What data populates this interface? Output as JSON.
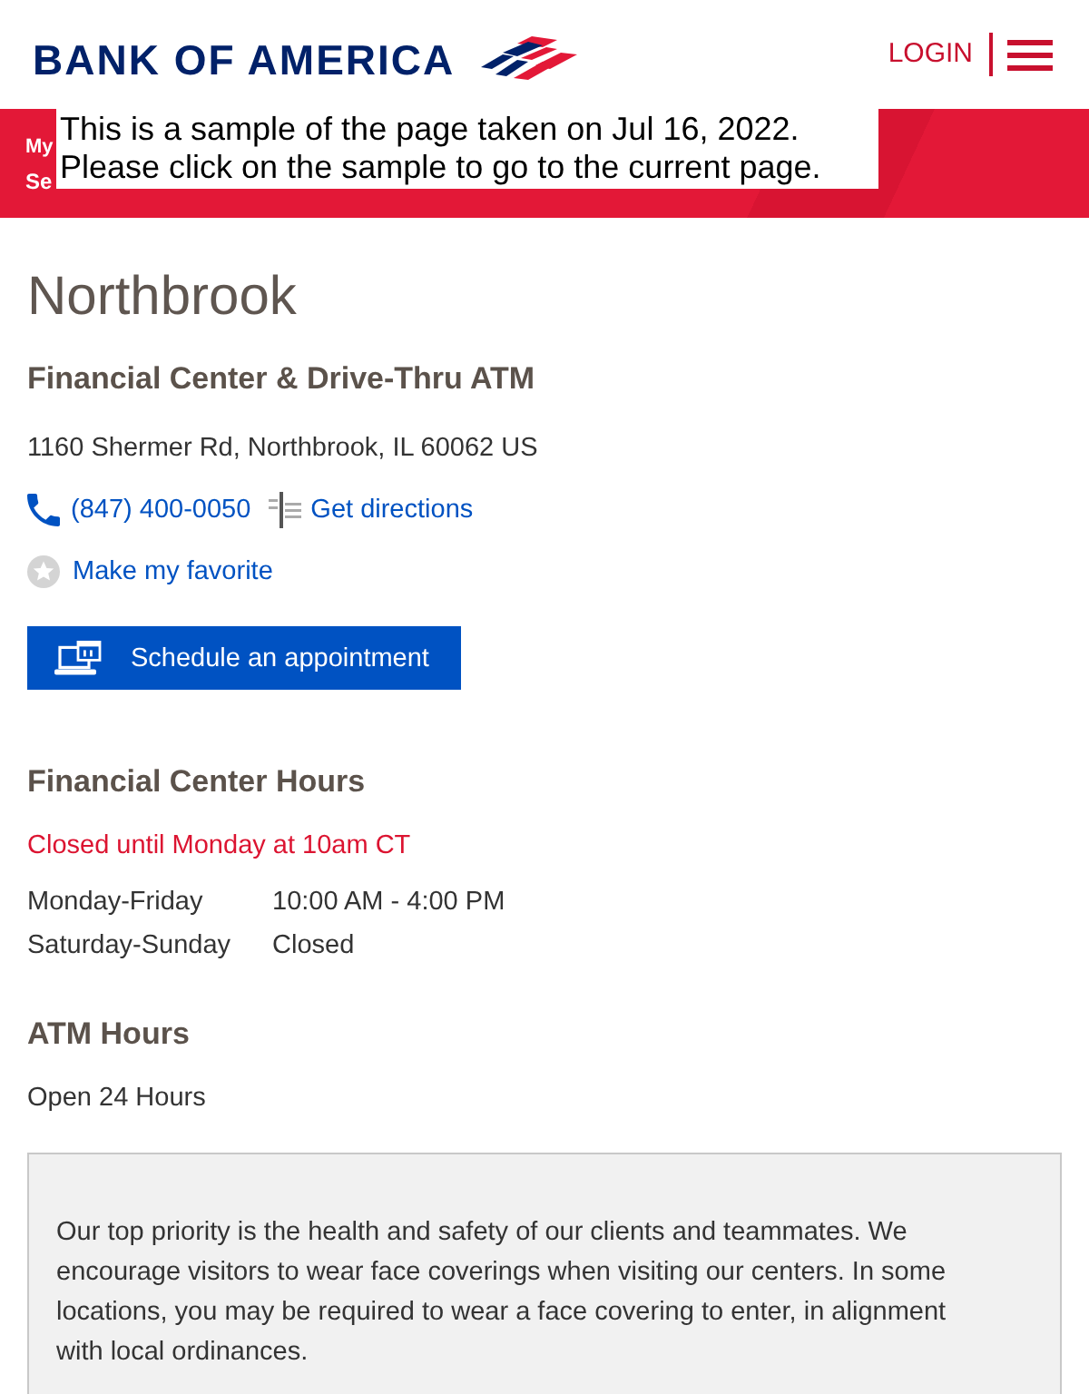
{
  "header": {
    "logo": "BANK OF AMERICA",
    "login": "LOGIN"
  },
  "banner": {
    "lines": [
      "My",
      "Se"
    ]
  },
  "sample_notice": [
    "This is a sample of the page taken on Jul 16, 2022.",
    "Please click on the sample to go to the current page."
  ],
  "location": {
    "city": "Northbrook",
    "type": "Financial Center & Drive-Thru ATM",
    "address": "1160 Shermer Rd, Northbrook, IL 60062 US",
    "phone": "(847) 400-0050",
    "directions": "Get directions",
    "favorite": {
      "label": "Make my favorite",
      "on": false
    },
    "appointment_button": "Schedule an appointment"
  },
  "financial_center_hours": {
    "title": "Financial Center Hours",
    "status": "Closed until Monday at 10am CT",
    "rows": [
      {
        "days": "Monday-Friday",
        "hours": "10:00 AM - 4:00 PM"
      },
      {
        "days": "Saturday-Sunday",
        "hours": "Closed"
      }
    ]
  },
  "atm_hours": {
    "title": "ATM Hours",
    "hours": "Open 24 Hours"
  },
  "notice": "Our top priority is the health and safety of our clients and teammates. We encourage visitors to wear face coverings when visiting our centers. In some locations, you may be required to wear a face covering to enter, in alignment with local ordinances."
}
